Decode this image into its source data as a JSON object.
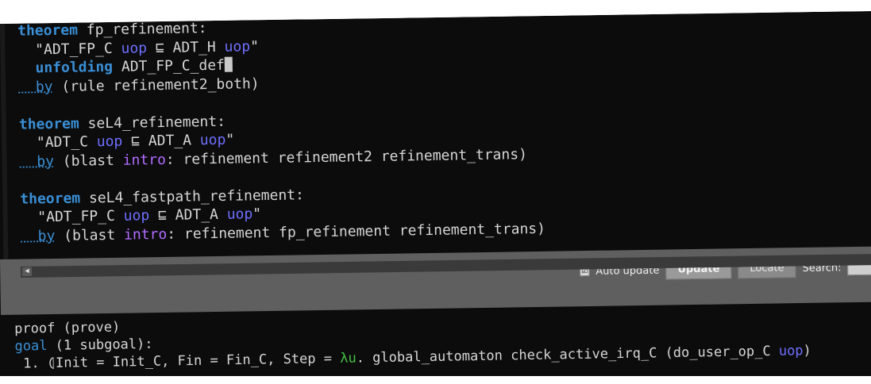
{
  "editor": {
    "lines": [
      {
        "kw": "theorem",
        "rest": " fp_refinement:"
      },
      {
        "text1": "  \"ADT_FP_C ",
        "var1": "uop",
        "text2": " ⊑ ADT_H ",
        "var2": "uop",
        "text3": "\""
      },
      {
        "kw": "  unfolding",
        "rest": " ADT_FP_C_def"
      },
      {
        "kw": "  by",
        "rest": " (rule refinement2_both)"
      },
      {
        "kw": "theorem",
        "rest": " seL4_refinement:"
      },
      {
        "text1": "  \"ADT_C ",
        "var1": "uop",
        "text2": " ⊑ ADT_A ",
        "var2": "uop",
        "text3": "\""
      },
      {
        "kw": "  by",
        "rest1": " (blast ",
        "intro": "intro",
        "rest2": ": refinement refinement2 refinement_trans)"
      },
      {
        "kw": "theorem",
        "rest": " seL4_fastpath_refinement:"
      },
      {
        "text1": "  \"ADT_FP_C ",
        "var1": "uop",
        "text2": " ⊑ ADT_A ",
        "var2": "uop",
        "text3": "\""
      },
      {
        "kw": "  by",
        "rest1": " (blast ",
        "intro": "intro",
        "rest2": ": refinement fp_refinement refinement_trans)"
      }
    ]
  },
  "scrollbar": {
    "left_arrow": "◀"
  },
  "toolbar": {
    "auto_update_label": "Auto update",
    "auto_update_checked": "☑",
    "update_label": "Update",
    "locate_label": "Locate",
    "search_label": "Search:"
  },
  "output": {
    "line1": "proof (prove)",
    "goal_kw": "goal",
    "goal_rest": " (1 subgoal):",
    "sub_prefix": " 1. ⦇Init = Init_C, Fin = Fin_C, Step = ",
    "lambda": "λu",
    "sub_mid": ". global_automaton check_active_irq_C (do_user_op_C ",
    "sub_var": "uop",
    "sub_end": ")"
  }
}
